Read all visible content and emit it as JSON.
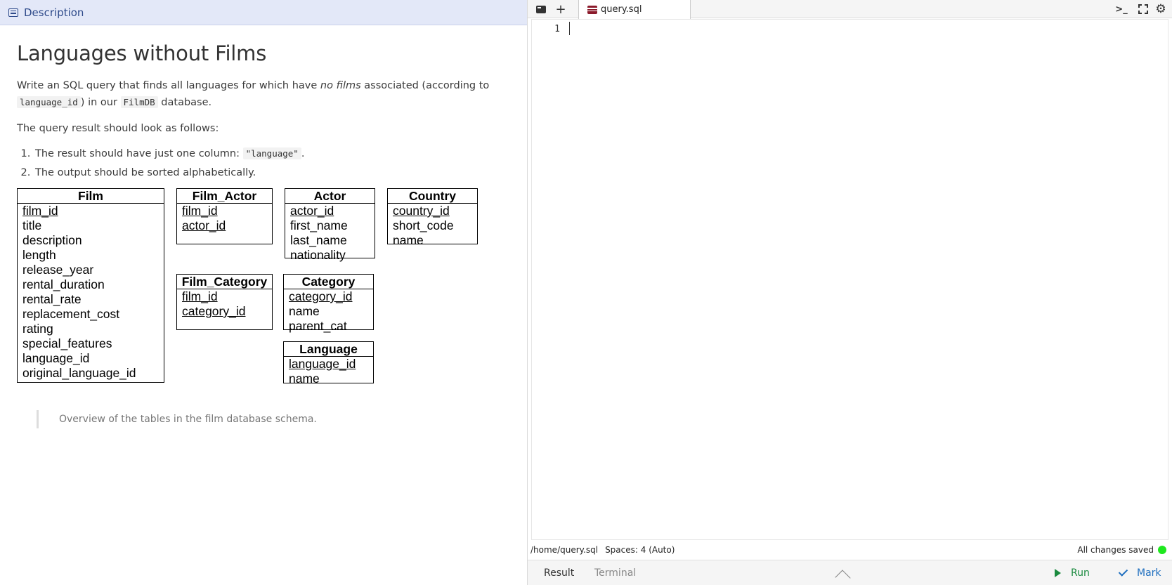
{
  "description_panel": {
    "header_title": "Description",
    "title": "Languages without Films",
    "intro": {
      "part1": "Write an SQL query that finds all languages for which have ",
      "emphasis": "no films",
      "part2": " associated (according to ",
      "code1": "language_id",
      "part3": ") in our ",
      "code2": "FilmDB",
      "part4": " database."
    },
    "result_intro": "The query result should look as follows:",
    "requirements": [
      {
        "text": "The result should have just one column: ",
        "code": "\"language\"",
        "suffix": "."
      },
      {
        "text": "The output should be sorted alphabetically."
      }
    ],
    "schema": {
      "tables": [
        {
          "name": "Film",
          "columns": [
            {
              "name": "film_id",
              "pk": true
            },
            {
              "name": "title"
            },
            {
              "name": "description"
            },
            {
              "name": "length"
            },
            {
              "name": "release_year"
            },
            {
              "name": "rental_duration"
            },
            {
              "name": "rental_rate"
            },
            {
              "name": "replacement_cost"
            },
            {
              "name": "rating"
            },
            {
              "name": "special_features"
            },
            {
              "name": "language_id"
            },
            {
              "name": "original_language_id"
            }
          ]
        },
        {
          "name": "Film_Actor",
          "columns": [
            {
              "name": "film_id",
              "pk": true
            },
            {
              "name": "actor_id",
              "pk": true
            }
          ]
        },
        {
          "name": "Actor",
          "columns": [
            {
              "name": "actor_id",
              "pk": true
            },
            {
              "name": "first_name"
            },
            {
              "name": "last_name"
            },
            {
              "name": "nationality"
            }
          ]
        },
        {
          "name": "Country",
          "columns": [
            {
              "name": "country_id",
              "pk": true
            },
            {
              "name": "short_code"
            },
            {
              "name": "name"
            }
          ]
        },
        {
          "name": "Film_Category",
          "columns": [
            {
              "name": "film_id",
              "pk": true
            },
            {
              "name": "category_id",
              "pk": true
            }
          ]
        },
        {
          "name": "Category",
          "columns": [
            {
              "name": "category_id",
              "pk": true
            },
            {
              "name": "name"
            },
            {
              "name": "parent_cat"
            }
          ]
        },
        {
          "name": "Language",
          "columns": [
            {
              "name": "language_id",
              "pk": true
            },
            {
              "name": "name"
            }
          ]
        }
      ]
    },
    "caption": "Overview of the tables in the film database schema."
  },
  "editor": {
    "tab_name": "query.sql",
    "line_numbers": [
      "1"
    ],
    "icons": [
      "files-icon",
      "add-tab-icon",
      "terminal-icon",
      "fullscreen-icon",
      "gear-icon"
    ]
  },
  "status": {
    "path": "/home/query.sql",
    "spaces": "Spaces: 4 (Auto)",
    "saved": "All changes saved",
    "saved_color": "#1ee81e"
  },
  "bottom": {
    "result_tab": "Result",
    "terminal_tab": "Terminal",
    "run_label": "Run",
    "mark_label": "Mark",
    "run_color": "#1a8a3f",
    "mark_color": "#1f6fbf"
  }
}
